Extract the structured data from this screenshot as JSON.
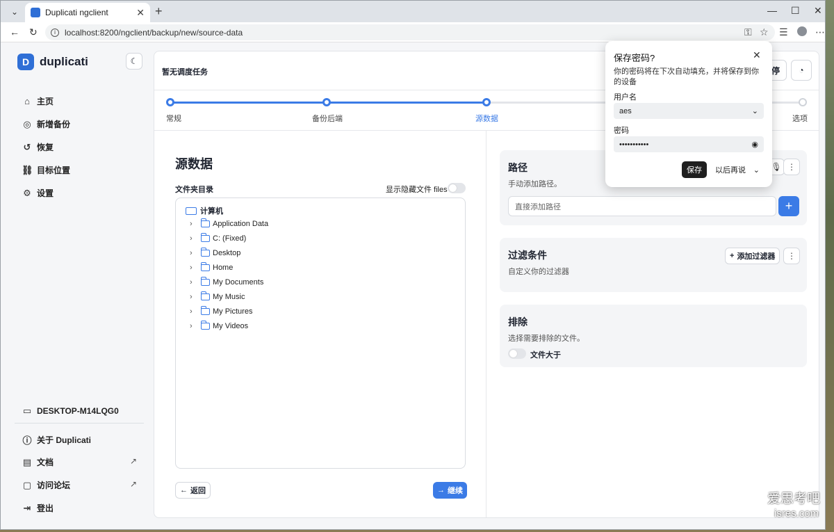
{
  "browser": {
    "tab_title": "Duplicati ngclient",
    "url": "localhost:8200/ngclient/backup/new/source-data"
  },
  "sidebar": {
    "logo": "duplicati",
    "items": [
      {
        "label": "主页",
        "icon": "home-icon"
      },
      {
        "label": "新增备份",
        "icon": "database-icon"
      },
      {
        "label": "恢复",
        "icon": "history-icon"
      },
      {
        "label": "目标位置",
        "icon": "link-icon"
      },
      {
        "label": "设置",
        "icon": "gear-icon"
      }
    ],
    "machine": "DESKTOP-M14LQG0",
    "bottom": [
      {
        "label": "关于 Duplicati",
        "icon": "info-icon"
      },
      {
        "label": "文档",
        "icon": "document-icon"
      },
      {
        "label": "访问论坛",
        "icon": "forum-icon"
      },
      {
        "label": "登出",
        "icon": "logout-icon"
      }
    ]
  },
  "header": {
    "schedule": "暂无调度任务",
    "pause_label": "停"
  },
  "stepper": {
    "steps": [
      "常规",
      "备份后端",
      "源数据",
      "选项"
    ],
    "active": "源数据"
  },
  "source": {
    "title": "源数据",
    "folder_label": "文件夹目录",
    "show_hidden": "显示隐藏文件 files",
    "root": "计算机",
    "folders": [
      "Application Data",
      "C: (Fixed)",
      "Desktop",
      "Home",
      "My Documents",
      "My Music",
      "My Pictures",
      "My Videos"
    ],
    "back": "返回",
    "continue": "继续"
  },
  "path": {
    "title": "路径",
    "subtitle": "手动添加路径。",
    "placeholder": "直接添加路径"
  },
  "filter": {
    "title": "过滤条件",
    "subtitle": "自定义你的过滤器",
    "add": "添加过滤器"
  },
  "exclude": {
    "title": "排除",
    "subtitle": "选择需要排除的文件。",
    "toggle_label": "文件大于"
  },
  "password_popup": {
    "title": "保存密码?",
    "description": "你的密码将在下次自动填充，并将保存到你的设备",
    "username_label": "用户名",
    "username": "aes",
    "password_label": "密码",
    "password": "•••••••••••",
    "save": "保存",
    "later": "以后再说"
  },
  "watermark": {
    "line1": "爱思考吧",
    "line2": "isres.com"
  }
}
